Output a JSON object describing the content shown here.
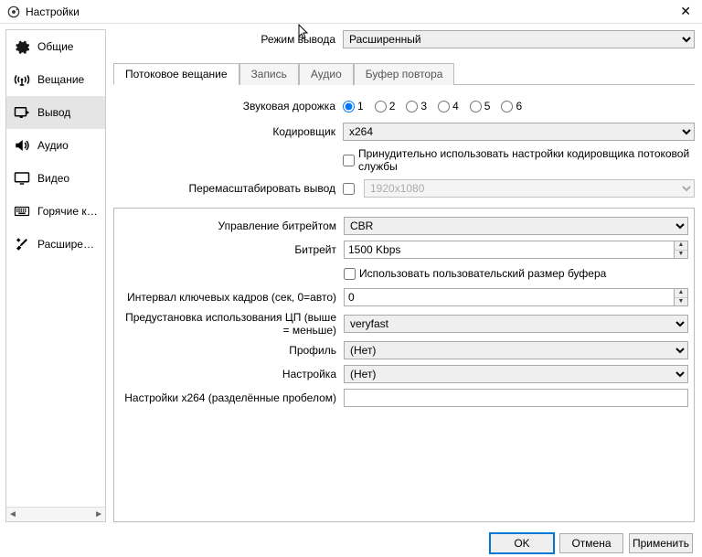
{
  "window": {
    "title": "Настройки"
  },
  "sidebar": {
    "items": [
      {
        "label": "Общие"
      },
      {
        "label": "Вещание"
      },
      {
        "label": "Вывод"
      },
      {
        "label": "Аудио"
      },
      {
        "label": "Видео"
      },
      {
        "label": "Горячие клави..."
      },
      {
        "label": "Расширенные"
      }
    ]
  },
  "top": {
    "output_mode_label": "Режим вывода",
    "output_mode_value": "Расширенный"
  },
  "tabs": {
    "streaming": "Потоковое вещание",
    "recording": "Запись",
    "audio": "Аудио",
    "replay": "Буфер повтора"
  },
  "form": {
    "audio_track_label": "Звуковая дорожка",
    "tracks": [
      "1",
      "2",
      "3",
      "4",
      "5",
      "6"
    ],
    "encoder_label": "Кодировщик",
    "encoder_value": "x264",
    "enforce_label": "Принудительно использовать настройки кодировщика потоковой службы",
    "rescale_label": "Перемасштабировать вывод",
    "rescale_value": "1920x1080"
  },
  "encoder": {
    "rate_control_label": "Управление битрейтом",
    "rate_control_value": "CBR",
    "bitrate_label": "Битрейт",
    "bitrate_value": "1500 Kbps",
    "custom_buffer_label": "Использовать пользовательский размер буфера",
    "keyframe_label": "Интервал ключевых кадров (сек, 0=авто)",
    "keyframe_value": "0",
    "preset_label": "Предустановка использования ЦП (выше = меньше)",
    "preset_value": "veryfast",
    "profile_label": "Профиль",
    "profile_value": "(Нет)",
    "tune_label": "Настройка",
    "tune_value": "(Нет)",
    "x264opts_label": "Настройки x264 (разделённые пробелом)",
    "x264opts_value": ""
  },
  "footer": {
    "ok": "OK",
    "cancel": "Отмена",
    "apply": "Применить"
  }
}
